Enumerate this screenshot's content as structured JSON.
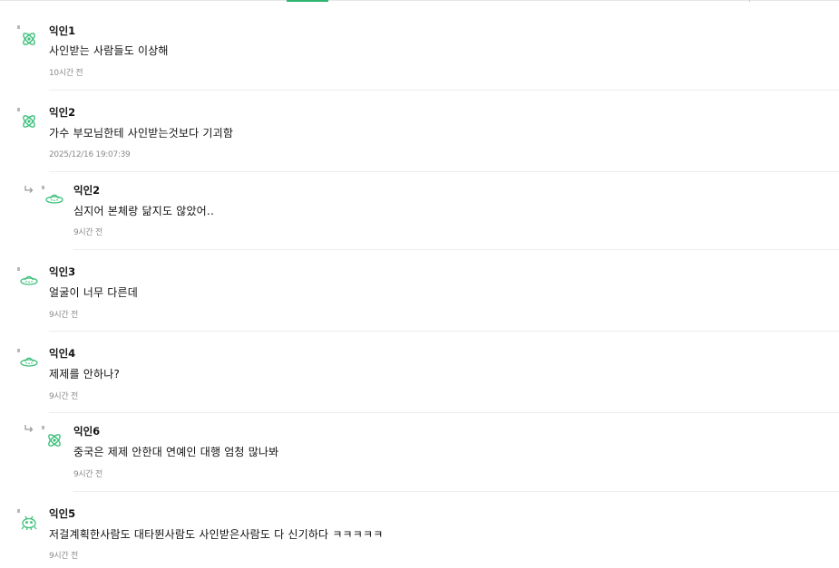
{
  "comments": [
    {
      "author": "익인1",
      "text": "사인받는 사람들도 이상해",
      "time": "10시간 전",
      "avatar_icon": "atom-icon",
      "is_reply": false
    },
    {
      "author": "익인2",
      "text": "가수 부모님한테 사인받는것보다 기괴함",
      "time": "2025/12/16 19:07:39",
      "avatar_icon": "atom-icon",
      "is_reply": false
    },
    {
      "author": "익인2",
      "text": "심지어 본체랑 닮지도 않았어..",
      "time": "9시간 전",
      "avatar_icon": "ufo-icon",
      "is_reply": true
    },
    {
      "author": "익인3",
      "text": "얼굴이 너무 다른데",
      "time": "9시간 전",
      "avatar_icon": "ufo-icon",
      "is_reply": false
    },
    {
      "author": "익인4",
      "text": "제제를 안하나?",
      "time": "9시간 전",
      "avatar_icon": "ufo-icon",
      "is_reply": false
    },
    {
      "author": "익인6",
      "text": "중국은 제제 안한대 연예인 대행 엄청 많나봐",
      "time": "9시간 전",
      "avatar_icon": "atom-icon",
      "is_reply": true
    },
    {
      "author": "익인5",
      "text": "저걸계획한사람도 대타뛴사람도 사인받은사람도 다 신기하다 ㅋㅋㅋㅋㅋ",
      "time": "9시간 전",
      "avatar_icon": "alien-icon",
      "is_reply": false
    }
  ],
  "colors": {
    "accent": "#2fb56f",
    "icon_green": "#3cc07a",
    "time_gray": "#8a8a8a",
    "divider": "#ececec"
  }
}
